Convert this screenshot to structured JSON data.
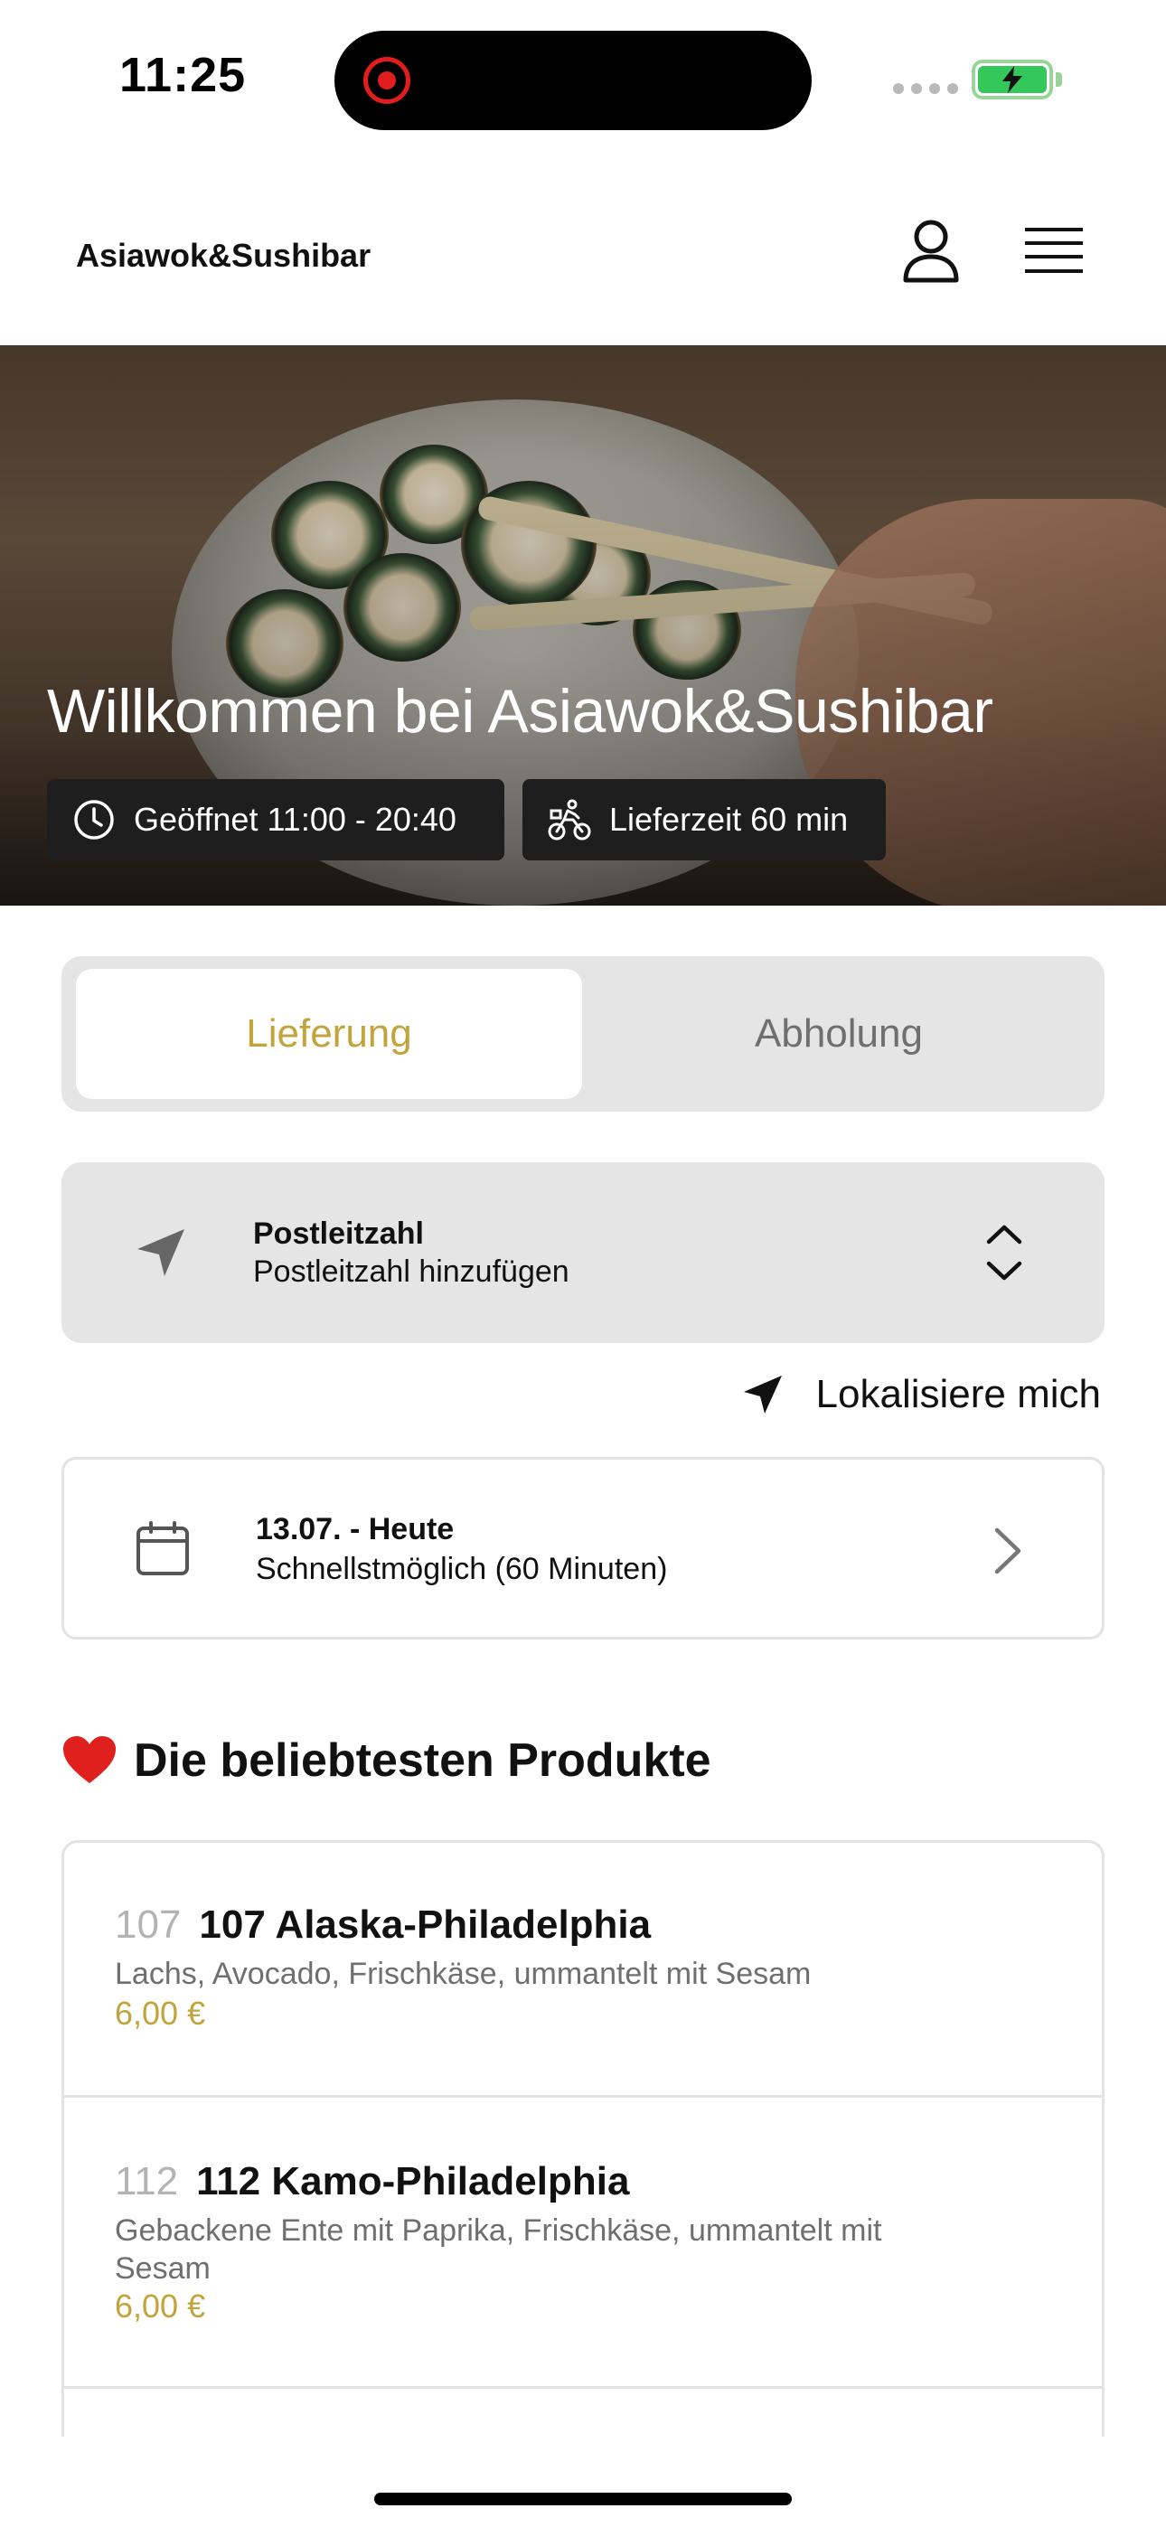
{
  "status_bar": {
    "time": "11:25"
  },
  "header": {
    "brand": "Asiawok&Sushibar",
    "icons": [
      "user-icon",
      "menu-icon"
    ]
  },
  "hero": {
    "title": "Willkommen bei Asiawok&Sushibar",
    "opening_hours": "Geöffnet 11:00 - 20:40",
    "delivery_time": "Lieferzeit 60 min"
  },
  "order_mode": {
    "options": [
      "Lieferung",
      "Abholung"
    ],
    "selected": "Lieferung"
  },
  "postcode": {
    "label": "Postleitzahl",
    "value": "Postleitzahl hinzufügen"
  },
  "locate_label": "Lokalisiere mich",
  "schedule": {
    "date": "13.07. - Heute",
    "time": "Schnellstmöglich (60 Minuten)"
  },
  "popular": {
    "heading": "Die beliebtesten Produkte",
    "products": [
      {
        "number": "107",
        "name": "107 Alaska-Philadelphia",
        "description": "Lachs, Avocado, Frischkäse, ummantelt mit Sesam",
        "price": "6,00 €"
      },
      {
        "number": "112",
        "name": "112 Kamo-Philadelphia",
        "description": "Gebackene Ente mit Paprika, Frischkäse, ummantelt mit Sesam",
        "price": "6,00 €"
      }
    ]
  },
  "colors": {
    "accent": "#c2a43c",
    "panel": "#e5e5e5",
    "badge_bg": "#1e1e1e",
    "battery": "#34c759",
    "recording": "#e11d1d"
  }
}
